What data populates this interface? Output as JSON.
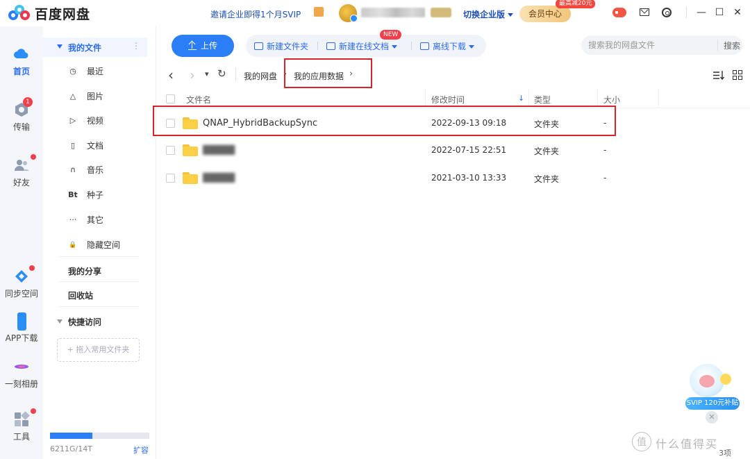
{
  "app": {
    "title": "百度网盘"
  },
  "topbar": {
    "invite": "邀请企业即得1个月SVIP",
    "switch_enterprise": "切换企业版",
    "member_center": "会员中心",
    "member_tip": "最高减20元",
    "window": {
      "minimize": "—",
      "maximize": "☐",
      "close": "✕"
    }
  },
  "rail": {
    "items": [
      {
        "label": "首页",
        "icon": "cloud-icon",
        "active": true
      },
      {
        "label": "传输",
        "icon": "transfer-icon",
        "badge": "1"
      },
      {
        "label": "好友",
        "icon": "friends-icon",
        "dot": true
      },
      {
        "label": "同步空间",
        "icon": "sync-icon",
        "dot": true
      },
      {
        "label": "APP下载",
        "icon": "phone-icon"
      },
      {
        "label": "一刻相册",
        "icon": "album-icon"
      },
      {
        "label": "工具",
        "icon": "tools-icon",
        "dot": true
      }
    ]
  },
  "sidebar": {
    "my_files": "我的文件",
    "more": "⋮",
    "items": [
      {
        "label": "最近",
        "icon": "clock-icon",
        "glyph": "◷"
      },
      {
        "label": "图片",
        "icon": "image-icon",
        "glyph": "△"
      },
      {
        "label": "视频",
        "icon": "play-icon",
        "glyph": "▷"
      },
      {
        "label": "文档",
        "icon": "doc-icon",
        "glyph": "▯"
      },
      {
        "label": "音乐",
        "icon": "headphone-icon",
        "glyph": "∩"
      },
      {
        "label": "种子",
        "icon": "bt-icon",
        "glyph": "Bt"
      },
      {
        "label": "其它",
        "icon": "more-icon",
        "glyph": "···"
      },
      {
        "label": "隐藏空间",
        "icon": "lock-icon",
        "glyph": "🔒"
      }
    ],
    "my_share": "我的分享",
    "recycle": "回收站",
    "quick_access": "快捷访问",
    "drag_hint": "+ 拖入常用文件夹",
    "quota_text": "6211G/14T",
    "quota_fraction": 0.43,
    "expand": "扩容"
  },
  "toolbar": {
    "upload": "上传",
    "new_folder": "新建文件夹",
    "new_doc": "新建在线文档",
    "new_badge": "NEW",
    "offline_download": "离线下载",
    "search_placeholder": "搜索我的网盘文件",
    "search_btn": "搜索"
  },
  "breadcrumb": {
    "back": "‹",
    "forward": "›",
    "dropdown": "▾",
    "refresh": "↻",
    "root": "我的网盘",
    "current": "我的应用数据",
    "sep": "›"
  },
  "table": {
    "columns": {
      "name": "文件名",
      "modified": "修改时间",
      "type": "类型",
      "size": "大小"
    },
    "rows": [
      {
        "name": "QNAP_HybridBackupSync",
        "modified": "2022-09-13 09:18",
        "type": "文件夹",
        "size": "-",
        "blurred": false
      },
      {
        "name": "█████",
        "modified": "2022-07-15 22:51",
        "type": "文件夹",
        "size": "-",
        "blurred": true
      },
      {
        "name": "█████",
        "modified": "2021-03-10 13:33",
        "type": "文件夹",
        "size": "-",
        "blurred": true
      }
    ]
  },
  "promo": {
    "label": "SVIP 120元补贴",
    "close": "✕"
  },
  "status": {
    "count": "3项"
  },
  "watermark": {
    "text": "什么值得买",
    "mark": "值"
  },
  "colors": {
    "accent": "#2b7ef6",
    "annotation": "#d8232a",
    "folder": "#fbcf45"
  }
}
